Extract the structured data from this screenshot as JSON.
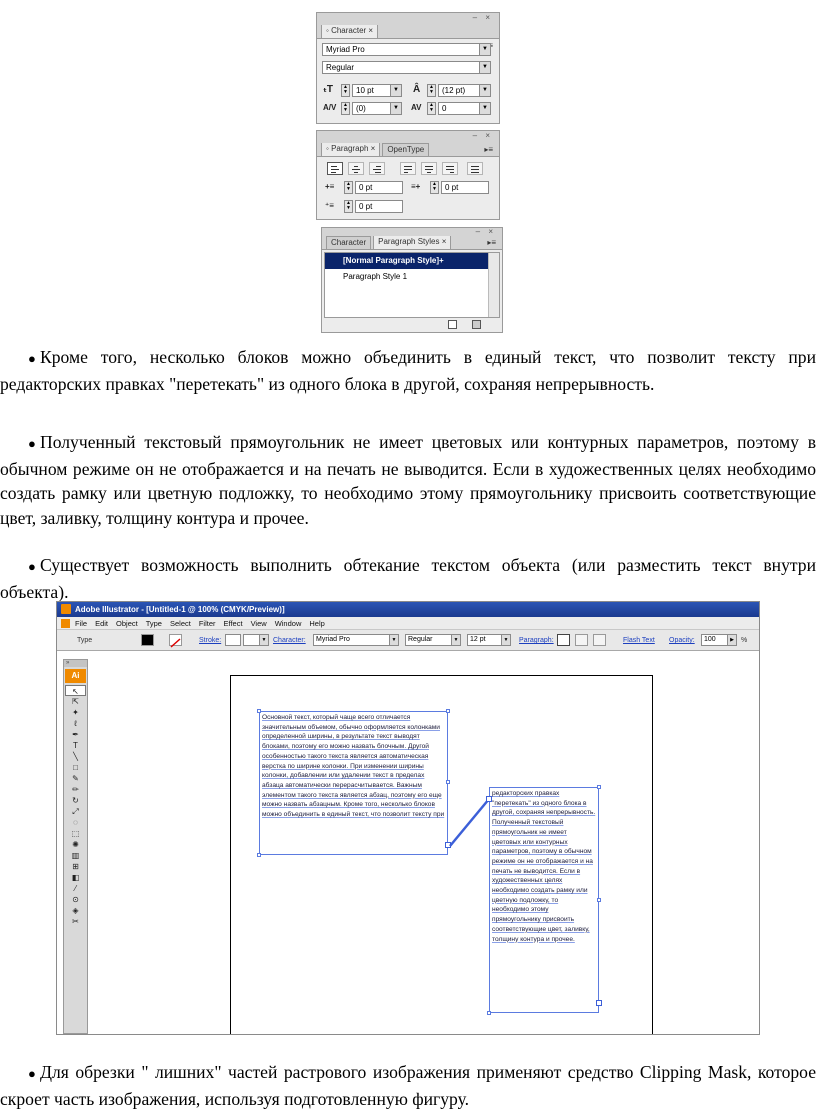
{
  "character_panel": {
    "tab": "Character",
    "font": "Myriad Pro",
    "style": "Regular",
    "size": "10 pt",
    "leading": "(12 pt)",
    "kerning": "(0)",
    "tracking": "0"
  },
  "paragraph_panel": {
    "tabs": [
      "Paragraph",
      "OpenType"
    ],
    "left_indent": "0 pt",
    "right_indent": "0 pt",
    "first_line_indent": "0 pt"
  },
  "styles_panel": {
    "tabs": [
      "Character",
      "Paragraph Styles"
    ],
    "items": [
      "[Normal Paragraph Style]+",
      "Paragraph Style 1"
    ]
  },
  "paragraphs": {
    "p1": "Кроме того, несколько блоков можно объединить в единый текст, что позволит тексту при редакторских правках \"перетекать\" из одного блока в другой, сохраняя непрерывность.",
    "p2": "Полученный текстовый прямоугольник не имеет цветовых или контурных параметров, поэтому в обычном режиме он не отображается и на печать не выводится. Если в художественных целях необходимо создать рамку или цветную подложку, то необходимо этому прямоугольнику присвоить соответствующие цвет, заливку, толщину контура и прочее.",
    "p3": "Существует возможность выполнить обтекание текстом объекта (или разместить текст внутри объекта).",
    "p4": "Для обрезки \" лишних\" частей растрового изображения применяют средство Clipping Mask, которое скроет часть изображения, используя подготовленную фигуру."
  },
  "illustrator": {
    "title": "Adobe Illustrator - [Untitled-1 @ 100% (CMYK/Preview)]",
    "menu": [
      "File",
      "Edit",
      "Object",
      "Type",
      "Select",
      "Filter",
      "Effect",
      "View",
      "Window",
      "Help"
    ],
    "control": {
      "type_label": "Type",
      "stroke_label": "Stroke:",
      "character_label": "Character:",
      "font": "Myriad Pro",
      "style": "Regular",
      "size": "12 pt",
      "paragraph_label": "Paragraph:",
      "flash_text": "Flash Text",
      "opacity_label": "Opacity:",
      "opacity_value": "100",
      "percent": "%"
    },
    "ai_badge": "Ai",
    "text_block_1": "Основной текст, который чаще всего отличается значительным объемом, обычно оформляется колонками определенной ширины, в результате текст выводят блоками, поэтому его можно назвать блочным. Другой особенностью такого текста является автоматическая верстка по ширине колонки. При изменении ширины колонки, добавлении или удалении текст в пределах абзаца автоматически перерасчитывается. Важным элементом такого текста является абзац, поэтому его еще можно назвать абзацным. Кроме того, несколько блоков можно объединить в единый текст, что позволит тексту при",
    "text_block_2": "редакторских правках \"перетекать\" из одного блока в другой, сохраняя непрерывность. Полученный текстовый прямоугольник не имеет цветовых или контурных параметров, поэтому в обычном режиме он не отображается и на печать не выводится. Если в художественных целях необходимо создать рамку или цветную подложку, то необходимо этому прямоугольнику присвоить соответствующие цвет, заливку, толщину контура и прочее."
  }
}
